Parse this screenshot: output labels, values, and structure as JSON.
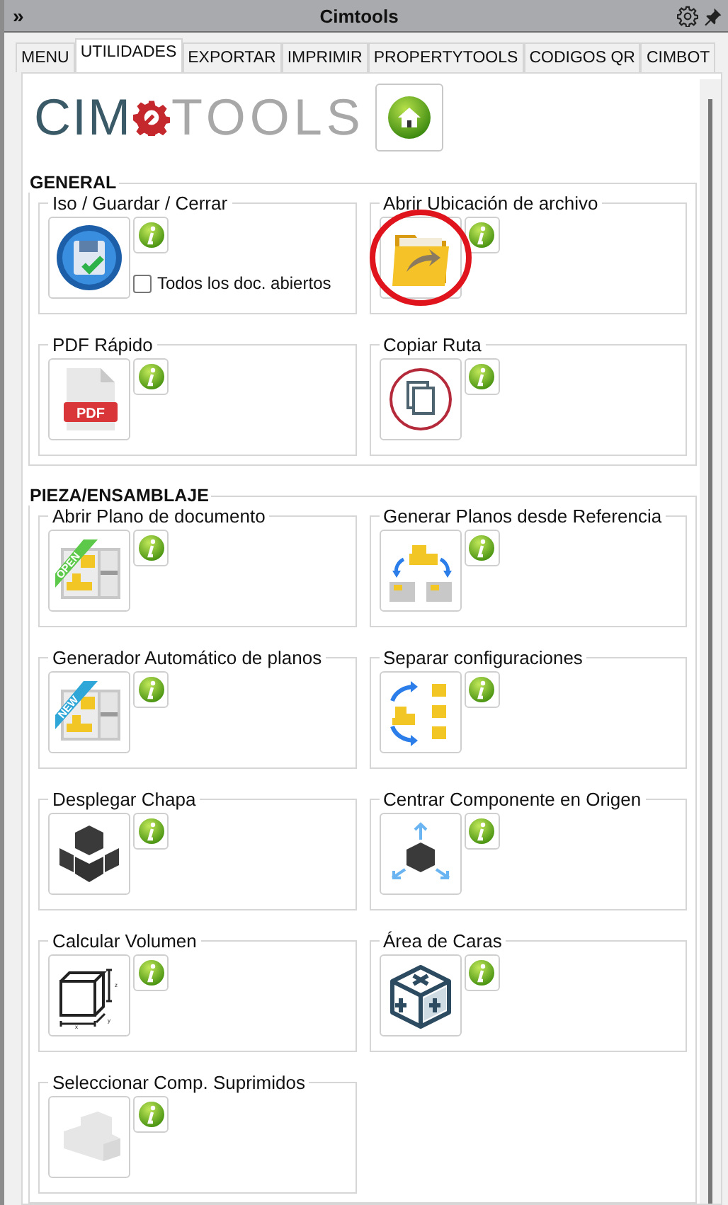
{
  "window": {
    "title": "Cimtools",
    "collapse_glyph": "»"
  },
  "tabs": [
    {
      "label": "MENU",
      "selected": false
    },
    {
      "label": "UTILIDADES",
      "selected": true
    },
    {
      "label": "EXPORTAR",
      "selected": false
    },
    {
      "label": "IMPRIMIR",
      "selected": false
    },
    {
      "label": "PROPERTYTOOLS",
      "selected": false
    },
    {
      "label": "CODIGOS QR",
      "selected": false
    },
    {
      "label": "CIMBOT",
      "selected": false
    }
  ],
  "logo": {
    "left": "CIM",
    "right": "TOOLS"
  },
  "sections": [
    {
      "title": "GENERAL",
      "tools": [
        {
          "title": "Iso / Guardar / Cerrar",
          "kind": "save",
          "highlighted": false,
          "option": {
            "label": "Todos los doc. abiertos",
            "checked": false
          }
        },
        {
          "title": "Abrir Ubicación de archivo",
          "kind": "folder",
          "highlighted": true
        },
        {
          "title": "PDF Rápido",
          "kind": "pdf",
          "highlighted": false,
          "icon_text": "PDF"
        },
        {
          "title": "Copiar Ruta",
          "kind": "copy",
          "highlighted": false
        }
      ]
    },
    {
      "title": "PIEZA/ENSAMBLAJE",
      "tools": [
        {
          "title": "Abrir Plano de documento",
          "kind": "plan",
          "highlighted": false,
          "icon_text": "OPEN",
          "color": "#5cc94a"
        },
        {
          "title": "Generar Planos desde Referencia",
          "kind": "reference",
          "highlighted": false
        },
        {
          "title": "Generador Automático de planos",
          "kind": "plan",
          "highlighted": false,
          "icon_text": "NEW",
          "color": "#2fa6d8"
        },
        {
          "title": "Separar configuraciones",
          "kind": "split",
          "highlighted": false
        },
        {
          "title": "Desplegar Chapa",
          "kind": "sheet",
          "highlighted": false
        },
        {
          "title": "Centrar Componente en Origen",
          "kind": "center",
          "highlighted": false
        },
        {
          "title": "Calcular Volumen",
          "kind": "volume",
          "highlighted": false,
          "axes": [
            "x",
            "y",
            "z"
          ]
        },
        {
          "title": "Área de Caras",
          "kind": "faces",
          "highlighted": false
        },
        {
          "title": "Seleccionar Comp. Suprimidos",
          "kind": "suppressed",
          "highlighted": false
        }
      ]
    }
  ]
}
